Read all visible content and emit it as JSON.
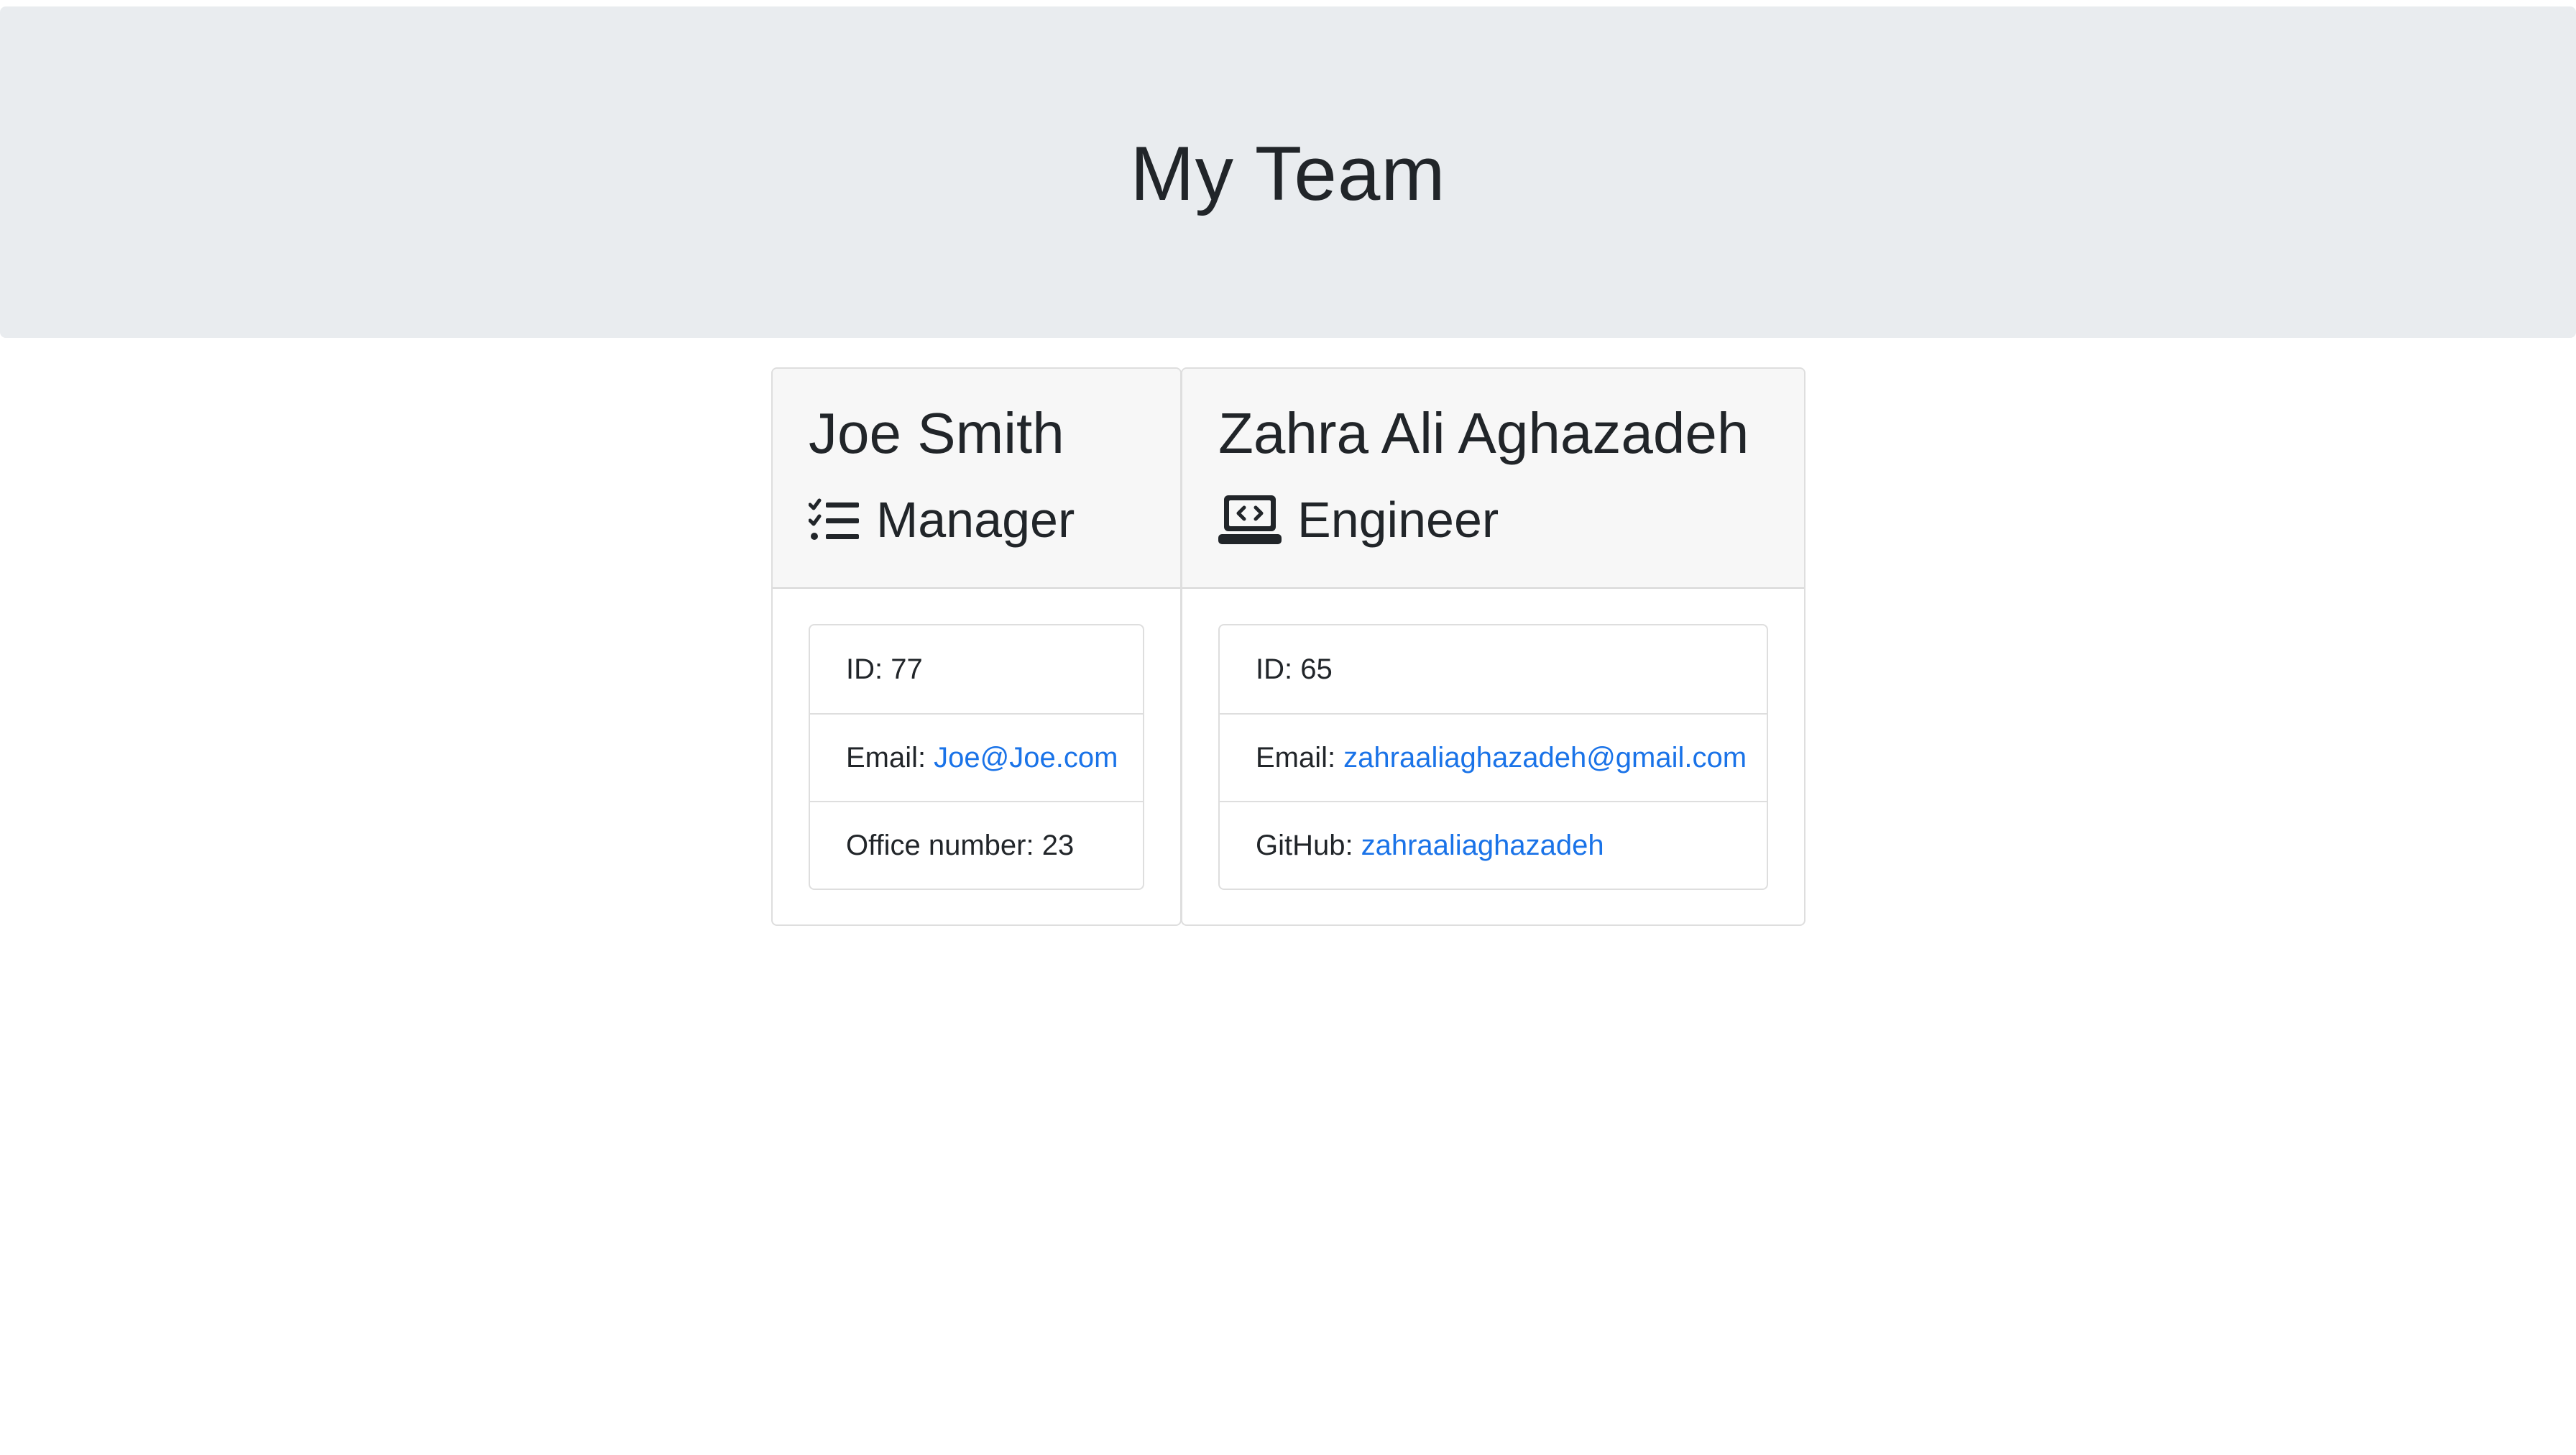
{
  "header": {
    "title": "My Team"
  },
  "colors": {
    "jumbotron_bg": "#e9ecef",
    "card_header_bg": "#f7f7f7",
    "link": "#1a73e8",
    "text": "#212529"
  },
  "cards": [
    {
      "name": "Joe Smith",
      "role": "Manager",
      "role_icon": "tasks-checklist-icon",
      "id_label": "ID: 77",
      "email_label": "Email:",
      "email": "Joe@Joe.com",
      "extra_label": "Office number: 23"
    },
    {
      "name": "Zahra Ali Aghazadeh",
      "role": "Engineer",
      "role_icon": "laptop-code-icon",
      "id_label": "ID: 65",
      "email_label": "Email:",
      "email": "zahraaliaghazadeh@gmail.com",
      "github_label": "GitHub:",
      "github": "zahraaliaghazadeh"
    }
  ]
}
